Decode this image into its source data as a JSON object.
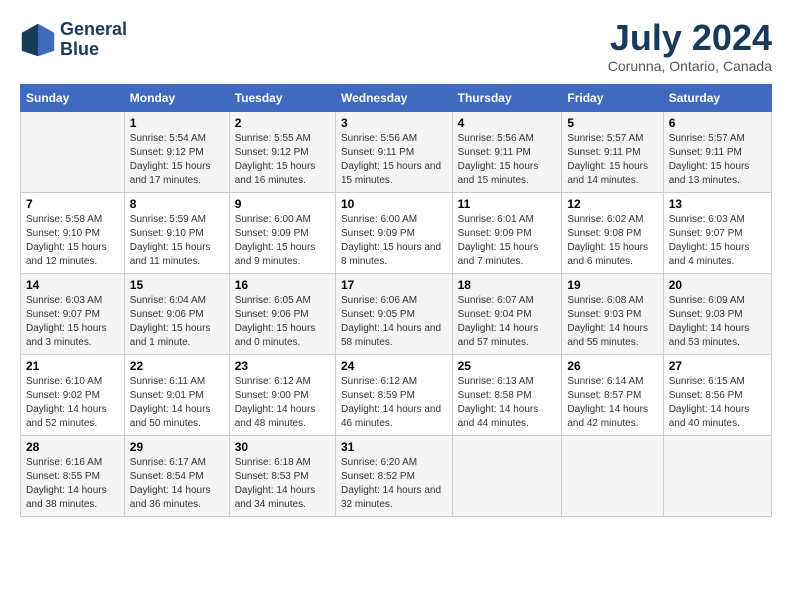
{
  "header": {
    "logo_line1": "General",
    "logo_line2": "Blue",
    "title": "July 2024",
    "subtitle": "Corunna, Ontario, Canada"
  },
  "days_of_week": [
    "Sunday",
    "Monday",
    "Tuesday",
    "Wednesday",
    "Thursday",
    "Friday",
    "Saturday"
  ],
  "weeks": [
    [
      {
        "day": "",
        "sunrise": "",
        "sunset": "",
        "daylight": ""
      },
      {
        "day": "1",
        "sunrise": "Sunrise: 5:54 AM",
        "sunset": "Sunset: 9:12 PM",
        "daylight": "Daylight: 15 hours and 17 minutes."
      },
      {
        "day": "2",
        "sunrise": "Sunrise: 5:55 AM",
        "sunset": "Sunset: 9:12 PM",
        "daylight": "Daylight: 15 hours and 16 minutes."
      },
      {
        "day": "3",
        "sunrise": "Sunrise: 5:56 AM",
        "sunset": "Sunset: 9:11 PM",
        "daylight": "Daylight: 15 hours and 15 minutes."
      },
      {
        "day": "4",
        "sunrise": "Sunrise: 5:56 AM",
        "sunset": "Sunset: 9:11 PM",
        "daylight": "Daylight: 15 hours and 15 minutes."
      },
      {
        "day": "5",
        "sunrise": "Sunrise: 5:57 AM",
        "sunset": "Sunset: 9:11 PM",
        "daylight": "Daylight: 15 hours and 14 minutes."
      },
      {
        "day": "6",
        "sunrise": "Sunrise: 5:57 AM",
        "sunset": "Sunset: 9:11 PM",
        "daylight": "Daylight: 15 hours and 13 minutes."
      }
    ],
    [
      {
        "day": "7",
        "sunrise": "Sunrise: 5:58 AM",
        "sunset": "Sunset: 9:10 PM",
        "daylight": "Daylight: 15 hours and 12 minutes."
      },
      {
        "day": "8",
        "sunrise": "Sunrise: 5:59 AM",
        "sunset": "Sunset: 9:10 PM",
        "daylight": "Daylight: 15 hours and 11 minutes."
      },
      {
        "day": "9",
        "sunrise": "Sunrise: 6:00 AM",
        "sunset": "Sunset: 9:09 PM",
        "daylight": "Daylight: 15 hours and 9 minutes."
      },
      {
        "day": "10",
        "sunrise": "Sunrise: 6:00 AM",
        "sunset": "Sunset: 9:09 PM",
        "daylight": "Daylight: 15 hours and 8 minutes."
      },
      {
        "day": "11",
        "sunrise": "Sunrise: 6:01 AM",
        "sunset": "Sunset: 9:09 PM",
        "daylight": "Daylight: 15 hours and 7 minutes."
      },
      {
        "day": "12",
        "sunrise": "Sunrise: 6:02 AM",
        "sunset": "Sunset: 9:08 PM",
        "daylight": "Daylight: 15 hours and 6 minutes."
      },
      {
        "day": "13",
        "sunrise": "Sunrise: 6:03 AM",
        "sunset": "Sunset: 9:07 PM",
        "daylight": "Daylight: 15 hours and 4 minutes."
      }
    ],
    [
      {
        "day": "14",
        "sunrise": "Sunrise: 6:03 AM",
        "sunset": "Sunset: 9:07 PM",
        "daylight": "Daylight: 15 hours and 3 minutes."
      },
      {
        "day": "15",
        "sunrise": "Sunrise: 6:04 AM",
        "sunset": "Sunset: 9:06 PM",
        "daylight": "Daylight: 15 hours and 1 minute."
      },
      {
        "day": "16",
        "sunrise": "Sunrise: 6:05 AM",
        "sunset": "Sunset: 9:06 PM",
        "daylight": "Daylight: 15 hours and 0 minutes."
      },
      {
        "day": "17",
        "sunrise": "Sunrise: 6:06 AM",
        "sunset": "Sunset: 9:05 PM",
        "daylight": "Daylight: 14 hours and 58 minutes."
      },
      {
        "day": "18",
        "sunrise": "Sunrise: 6:07 AM",
        "sunset": "Sunset: 9:04 PM",
        "daylight": "Daylight: 14 hours and 57 minutes."
      },
      {
        "day": "19",
        "sunrise": "Sunrise: 6:08 AM",
        "sunset": "Sunset: 9:03 PM",
        "daylight": "Daylight: 14 hours and 55 minutes."
      },
      {
        "day": "20",
        "sunrise": "Sunrise: 6:09 AM",
        "sunset": "Sunset: 9:03 PM",
        "daylight": "Daylight: 14 hours and 53 minutes."
      }
    ],
    [
      {
        "day": "21",
        "sunrise": "Sunrise: 6:10 AM",
        "sunset": "Sunset: 9:02 PM",
        "daylight": "Daylight: 14 hours and 52 minutes."
      },
      {
        "day": "22",
        "sunrise": "Sunrise: 6:11 AM",
        "sunset": "Sunset: 9:01 PM",
        "daylight": "Daylight: 14 hours and 50 minutes."
      },
      {
        "day": "23",
        "sunrise": "Sunrise: 6:12 AM",
        "sunset": "Sunset: 9:00 PM",
        "daylight": "Daylight: 14 hours and 48 minutes."
      },
      {
        "day": "24",
        "sunrise": "Sunrise: 6:12 AM",
        "sunset": "Sunset: 8:59 PM",
        "daylight": "Daylight: 14 hours and 46 minutes."
      },
      {
        "day": "25",
        "sunrise": "Sunrise: 6:13 AM",
        "sunset": "Sunset: 8:58 PM",
        "daylight": "Daylight: 14 hours and 44 minutes."
      },
      {
        "day": "26",
        "sunrise": "Sunrise: 6:14 AM",
        "sunset": "Sunset: 8:57 PM",
        "daylight": "Daylight: 14 hours and 42 minutes."
      },
      {
        "day": "27",
        "sunrise": "Sunrise: 6:15 AM",
        "sunset": "Sunset: 8:56 PM",
        "daylight": "Daylight: 14 hours and 40 minutes."
      }
    ],
    [
      {
        "day": "28",
        "sunrise": "Sunrise: 6:16 AM",
        "sunset": "Sunset: 8:55 PM",
        "daylight": "Daylight: 14 hours and 38 minutes."
      },
      {
        "day": "29",
        "sunrise": "Sunrise: 6:17 AM",
        "sunset": "Sunset: 8:54 PM",
        "daylight": "Daylight: 14 hours and 36 minutes."
      },
      {
        "day": "30",
        "sunrise": "Sunrise: 6:18 AM",
        "sunset": "Sunset: 8:53 PM",
        "daylight": "Daylight: 14 hours and 34 minutes."
      },
      {
        "day": "31",
        "sunrise": "Sunrise: 6:20 AM",
        "sunset": "Sunset: 8:52 PM",
        "daylight": "Daylight: 14 hours and 32 minutes."
      },
      {
        "day": "",
        "sunrise": "",
        "sunset": "",
        "daylight": ""
      },
      {
        "day": "",
        "sunrise": "",
        "sunset": "",
        "daylight": ""
      },
      {
        "day": "",
        "sunrise": "",
        "sunset": "",
        "daylight": ""
      }
    ]
  ]
}
